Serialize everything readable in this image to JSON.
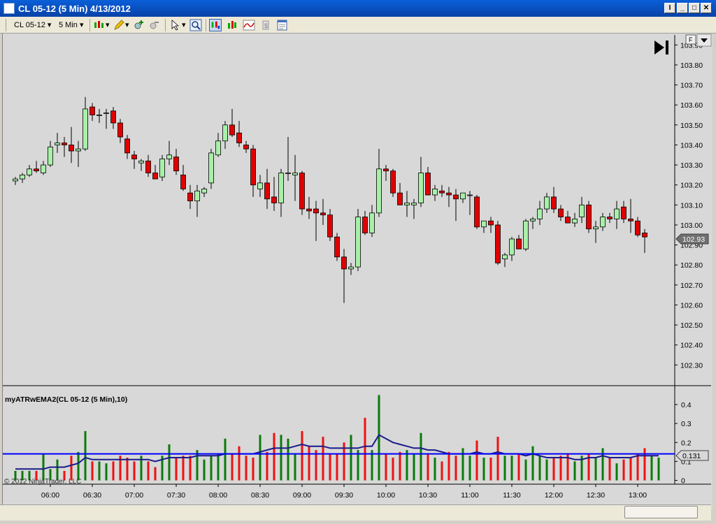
{
  "window": {
    "title": "CL 05-12 (5 Min)  4/13/2012"
  },
  "toolbar": {
    "instrument": "CL 05-12",
    "interval": "5 Min"
  },
  "panel": {
    "f_label": "F"
  },
  "indicator": {
    "label": "myATRwEMA2(CL 05-12 (5 Min),10)",
    "current_value": "0.131"
  },
  "copyright": "© 2012 NinjaTrader, LLC",
  "colors": {
    "up": "#a8f0a8",
    "down": "#e00000",
    "vol_up": "#0a7a0a",
    "vol_down": "#ee1111",
    "ema": "#1a1a8c",
    "hline": "#0000ff"
  },
  "chart_data": [
    {
      "type": "candlestick",
      "instrument": "CL 05-12",
      "interval": "5 Min",
      "ylim": [
        102.2,
        103.95
      ],
      "yticks": [
        "102.30",
        "102.40",
        "102.50",
        "102.60",
        "102.70",
        "102.80",
        "102.90",
        "103.00",
        "103.10",
        "103.20",
        "103.30",
        "103.40",
        "103.50",
        "103.60",
        "103.70",
        "103.80",
        "103.90"
      ],
      "xticks": [
        "06:00",
        "06:30",
        "07:00",
        "07:30",
        "08:00",
        "08:30",
        "09:00",
        "09:30",
        "10:00",
        "10:30",
        "11:00",
        "11:30",
        "12:00",
        "12:30",
        "13:00"
      ],
      "last_price_label": "102.93",
      "ohlc": [
        [
          103.22,
          103.24,
          103.2,
          103.23
        ],
        [
          103.23,
          103.26,
          103.21,
          103.25
        ],
        [
          103.25,
          103.3,
          103.24,
          103.28
        ],
        [
          103.28,
          103.32,
          103.26,
          103.27
        ],
        [
          103.26,
          103.32,
          103.25,
          103.3
        ],
        [
          103.3,
          103.42,
          103.29,
          103.39
        ],
        [
          103.4,
          103.46,
          103.36,
          103.41
        ],
        [
          103.41,
          103.44,
          103.34,
          103.4
        ],
        [
          103.4,
          103.49,
          103.31,
          103.37
        ],
        [
          103.37,
          103.42,
          103.29,
          103.38
        ],
        [
          103.38,
          103.64,
          103.37,
          103.58
        ],
        [
          103.59,
          103.61,
          103.52,
          103.55
        ],
        [
          103.55,
          103.58,
          103.51,
          103.55
        ],
        [
          103.56,
          103.58,
          103.48,
          103.56
        ],
        [
          103.57,
          103.59,
          103.48,
          103.51
        ],
        [
          103.51,
          103.53,
          103.41,
          103.44
        ],
        [
          103.43,
          103.45,
          103.33,
          103.36
        ],
        [
          103.35,
          103.37,
          103.28,
          103.33
        ],
        [
          103.31,
          103.33,
          103.27,
          103.32
        ],
        [
          103.32,
          103.35,
          103.24,
          103.26
        ],
        [
          103.26,
          103.3,
          103.23,
          103.23
        ],
        [
          103.24,
          103.35,
          103.22,
          103.33
        ],
        [
          103.33,
          103.42,
          103.3,
          103.35
        ],
        [
          103.34,
          103.38,
          103.25,
          103.27
        ],
        [
          103.25,
          103.3,
          103.17,
          103.18
        ],
        [
          103.16,
          103.2,
          103.08,
          103.12
        ],
        [
          103.12,
          103.2,
          103.04,
          103.17
        ],
        [
          103.16,
          103.19,
          103.14,
          103.18
        ],
        [
          103.21,
          103.38,
          103.18,
          103.36
        ],
        [
          103.35,
          103.46,
          103.34,
          103.42
        ],
        [
          103.42,
          103.52,
          103.38,
          103.5
        ],
        [
          103.5,
          103.58,
          103.44,
          103.45
        ],
        [
          103.46,
          103.52,
          103.39,
          103.41
        ],
        [
          103.4,
          103.42,
          103.36,
          103.38
        ],
        [
          103.38,
          103.4,
          103.14,
          103.2
        ],
        [
          103.18,
          103.25,
          103.14,
          103.21
        ],
        [
          103.21,
          103.28,
          103.08,
          103.13
        ],
        [
          103.14,
          103.24,
          103.07,
          103.11
        ],
        [
          103.11,
          103.28,
          103.04,
          103.26
        ],
        [
          103.26,
          103.44,
          103.22,
          103.26
        ],
        [
          103.25,
          103.35,
          103.12,
          103.26
        ],
        [
          103.26,
          103.27,
          103.05,
          103.08
        ],
        [
          103.08,
          103.14,
          103.03,
          103.07
        ],
        [
          103.08,
          103.12,
          102.92,
          103.06
        ],
        [
          103.06,
          103.13,
          103.0,
          103.05
        ],
        [
          103.05,
          103.08,
          102.92,
          102.94
        ],
        [
          102.94,
          102.96,
          102.82,
          102.84
        ],
        [
          102.84,
          102.88,
          102.61,
          102.78
        ],
        [
          102.78,
          102.81,
          102.75,
          102.79
        ],
        [
          102.79,
          103.08,
          102.77,
          103.04
        ],
        [
          103.04,
          103.07,
          102.95,
          102.96
        ],
        [
          102.96,
          103.1,
          102.94,
          103.06
        ],
        [
          103.06,
          103.38,
          103.04,
          103.28
        ],
        [
          103.28,
          103.3,
          103.22,
          103.27
        ],
        [
          103.27,
          103.28,
          103.14,
          103.16
        ],
        [
          103.16,
          103.21,
          103.1,
          103.1
        ],
        [
          103.1,
          103.17,
          103.04,
          103.11
        ],
        [
          103.1,
          103.13,
          103.03,
          103.11
        ],
        [
          103.11,
          103.34,
          103.09,
          103.26
        ],
        [
          103.26,
          103.29,
          103.16,
          103.15
        ],
        [
          103.15,
          103.2,
          103.12,
          103.18
        ],
        [
          103.17,
          103.2,
          103.14,
          103.16
        ],
        [
          103.16,
          103.19,
          103.09,
          103.15
        ],
        [
          103.15,
          103.18,
          103.02,
          103.13
        ],
        [
          103.13,
          103.16,
          103.11,
          103.16
        ],
        [
          103.15,
          103.17,
          103.05,
          103.15
        ],
        [
          103.14,
          103.15,
          102.98,
          102.99
        ],
        [
          102.99,
          103.02,
          102.96,
          103.02
        ],
        [
          103.02,
          103.04,
          102.96,
          103.0
        ],
        [
          103.0,
          103.02,
          102.8,
          102.81
        ],
        [
          102.83,
          102.86,
          102.79,
          102.85
        ],
        [
          102.85,
          102.94,
          102.82,
          102.93
        ],
        [
          102.93,
          102.95,
          102.88,
          102.88
        ],
        [
          102.88,
          103.03,
          102.87,
          103.02
        ],
        [
          103.02,
          103.04,
          102.98,
          103.03
        ],
        [
          103.03,
          103.12,
          103.0,
          103.08
        ],
        [
          103.08,
          103.16,
          103.06,
          103.14
        ],
        [
          103.14,
          103.19,
          103.06,
          103.08
        ],
        [
          103.08,
          103.1,
          103.02,
          103.04
        ],
        [
          103.04,
          103.07,
          103.01,
          103.01
        ],
        [
          103.01,
          103.06,
          102.99,
          103.03
        ],
        [
          103.04,
          103.14,
          103.01,
          103.1
        ],
        [
          103.1,
          103.12,
          102.96,
          102.98
        ],
        [
          102.98,
          103.02,
          102.91,
          102.99
        ],
        [
          102.99,
          103.06,
          102.97,
          103.04
        ],
        [
          103.04,
          103.06,
          103.01,
          103.03
        ],
        [
          103.03,
          103.12,
          102.98,
          103.08
        ],
        [
          103.09,
          103.12,
          103.01,
          103.03
        ],
        [
          103.03,
          103.13,
          102.96,
          103.02
        ],
        [
          103.02,
          103.04,
          102.94,
          102.95
        ],
        [
          102.96,
          102.98,
          102.86,
          102.94
        ]
      ]
    },
    {
      "type": "bar",
      "name": "myATRwEMA2(CL 05-12 (5 Min),10)",
      "ylim": [
        -0.02,
        0.47
      ],
      "yticks": [
        "0",
        "0.1",
        "0.2",
        "0.3",
        "0.4"
      ],
      "hline": 0.14,
      "current_value_label": "0.131",
      "values": [
        0.05,
        0.05,
        0.05,
        0.05,
        0.14,
        0.06,
        0.11,
        0.05,
        0.13,
        0.15,
        0.26,
        0.1,
        0.1,
        0.09,
        0.1,
        0.13,
        0.12,
        0.1,
        0.13,
        0.1,
        0.07,
        0.13,
        0.19,
        0.12,
        0.13,
        0.13,
        0.16,
        0.11,
        0.13,
        0.14,
        0.22,
        0.14,
        0.18,
        0.13,
        0.12,
        0.24,
        0.15,
        0.25,
        0.24,
        0.22,
        0.14,
        0.26,
        0.18,
        0.16,
        0.23,
        0.14,
        0.14,
        0.2,
        0.24,
        0.16,
        0.33,
        0.16,
        0.45,
        0.14,
        0.12,
        0.15,
        0.16,
        0.14,
        0.25,
        0.14,
        0.12,
        0.1,
        0.15,
        0.13,
        0.17,
        0.13,
        0.21,
        0.12,
        0.12,
        0.23,
        0.13,
        0.13,
        0.14,
        0.11,
        0.18,
        0.13,
        0.11,
        0.12,
        0.13,
        0.14,
        0.1,
        0.13,
        0.14,
        0.12,
        0.17,
        0.12,
        0.09,
        0.11,
        0.12,
        0.14,
        0.17,
        0.13,
        0.12
      ],
      "ema": [
        0.06,
        0.06,
        0.06,
        0.06,
        0.06,
        0.07,
        0.07,
        0.07,
        0.08,
        0.09,
        0.12,
        0.11,
        0.11,
        0.11,
        0.11,
        0.11,
        0.11,
        0.11,
        0.11,
        0.11,
        0.1,
        0.11,
        0.12,
        0.12,
        0.12,
        0.12,
        0.13,
        0.13,
        0.13,
        0.13,
        0.14,
        0.14,
        0.14,
        0.14,
        0.14,
        0.15,
        0.16,
        0.17,
        0.17,
        0.17,
        0.18,
        0.19,
        0.18,
        0.18,
        0.18,
        0.17,
        0.17,
        0.17,
        0.17,
        0.17,
        0.18,
        0.18,
        0.24,
        0.22,
        0.2,
        0.19,
        0.18,
        0.17,
        0.17,
        0.16,
        0.16,
        0.15,
        0.14,
        0.14,
        0.14,
        0.14,
        0.15,
        0.14,
        0.14,
        0.15,
        0.14,
        0.14,
        0.14,
        0.13,
        0.14,
        0.13,
        0.12,
        0.12,
        0.12,
        0.12,
        0.11,
        0.11,
        0.12,
        0.12,
        0.13,
        0.12,
        0.12,
        0.12,
        0.12,
        0.13,
        0.13,
        0.13,
        0.13
      ]
    }
  ]
}
